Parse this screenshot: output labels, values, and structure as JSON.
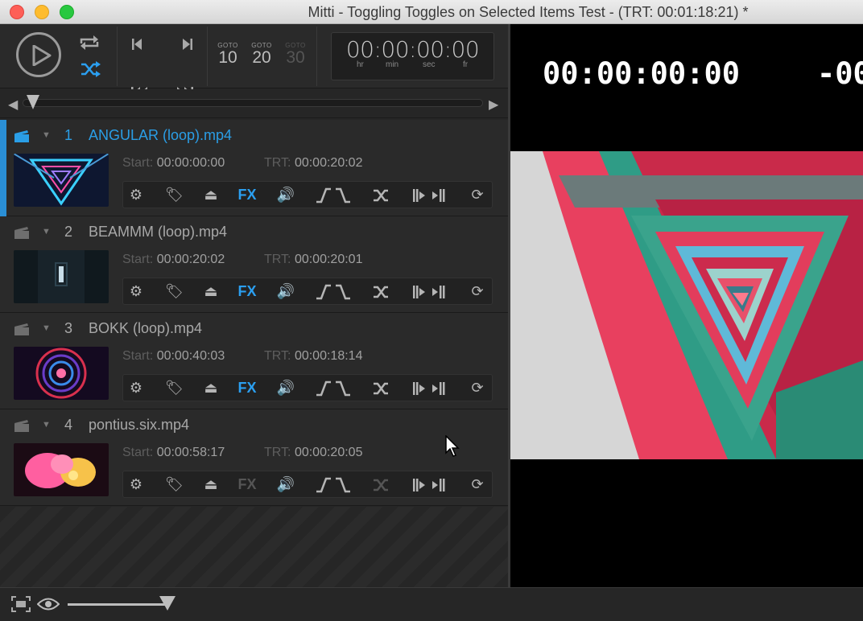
{
  "window": {
    "title": "Mitti - Toggling Toggles on Selected Items Test - (TRT: 00:01:18:21) *"
  },
  "transport": {
    "goto": [
      {
        "label": "GOTO",
        "value": "10",
        "enabled": true
      },
      {
        "label": "GOTO",
        "value": "20",
        "enabled": true
      },
      {
        "label": "GOTO",
        "value": "30",
        "enabled": false
      }
    ],
    "timecode": {
      "value": "00:00:00:00",
      "units": [
        "hr",
        "min",
        "sec",
        "fr"
      ]
    }
  },
  "playlist": {
    "items": [
      {
        "index": "1",
        "name": "ANGULAR (loop).mp4",
        "start_label": "Start:",
        "start": "00:00:00:00",
        "trt_label": "TRT:",
        "trt": "00:00:20:02",
        "selected": true,
        "fx_label": "FX",
        "fx_on": true,
        "shuffle_on": true
      },
      {
        "index": "2",
        "name": "BEAMMM (loop).mp4",
        "start_label": "Start:",
        "start": "00:00:20:02",
        "trt_label": "TRT:",
        "trt": "00:00:20:01",
        "selected": false,
        "fx_label": "FX",
        "fx_on": true,
        "shuffle_on": true
      },
      {
        "index": "3",
        "name": "BOKK (loop).mp4",
        "start_label": "Start:",
        "start": "00:00:40:03",
        "trt_label": "TRT:",
        "trt": "00:00:18:14",
        "selected": false,
        "fx_label": "FX",
        "fx_on": true,
        "shuffle_on": true
      },
      {
        "index": "4",
        "name": "pontius.six.mp4",
        "start_label": "Start:",
        "start": "00:00:58:17",
        "trt_label": "TRT:",
        "trt": "00:00:20:05",
        "selected": false,
        "fx_label": "FX",
        "fx_on": false,
        "shuffle_on": false
      }
    ]
  },
  "output": {
    "elapsed_timecode": "00:00:00:00",
    "remaining_timecode_partial": "-00"
  },
  "colors": {
    "accent": "#2a9ee6",
    "panel": "#262626",
    "selected_bar": "#2a8fd6"
  }
}
